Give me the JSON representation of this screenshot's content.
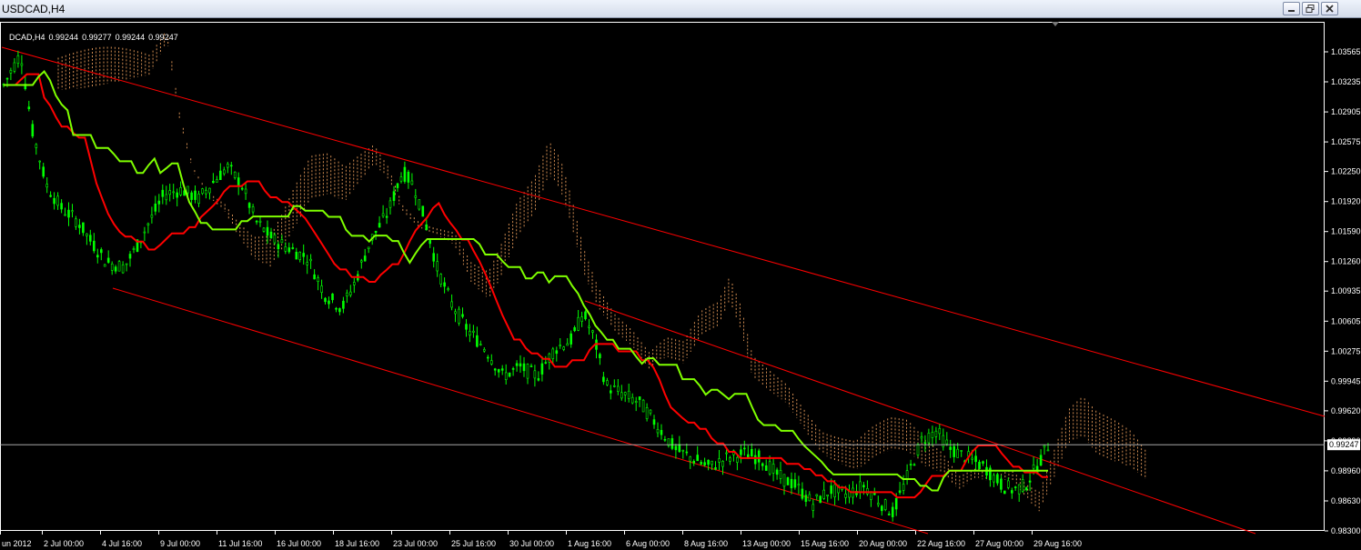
{
  "window": {
    "title": "USDCAD,H4",
    "buttons": {
      "minimize": "minimize",
      "restore": "restore",
      "close": "close"
    }
  },
  "info_line": {
    "symbol_label": "DCAD,H4",
    "open": "0.99244",
    "high": "0.99277",
    "low": "0.99244",
    "close": "0.99247"
  },
  "colors": {
    "background": "#000000",
    "candles": "#00ff00",
    "tenkan": "#ff0000",
    "kijun": "#7fff00",
    "cloud_bull": "#f4a460",
    "cloud_bear": "#ffffff",
    "channel": "#ff0000",
    "axis": "#ffffff"
  },
  "chart_data": {
    "type": "line",
    "price_axis": {
      "ticks": [
        "1.03565",
        "1.03235",
        "1.02905",
        "1.02575",
        "1.02250",
        "1.01920",
        "1.01590",
        "1.01260",
        "1.00935",
        "1.00605",
        "1.00275",
        "0.99945",
        "0.99620",
        "0.99290",
        "0.98960",
        "0.98630",
        "0.98300"
      ],
      "ylim": [
        0.983,
        1.03565
      ],
      "current_price_label": "0.99247",
      "current_price": 0.99247
    },
    "time_axis": {
      "ticks": [
        "un 2012",
        "2 Jul 00:00",
        "4 Jul 16:00",
        "9 Jul 00:00",
        "11 Jul 16:00",
        "16 Jul 00:00",
        "18 Jul 16:00",
        "23 Jul 00:00",
        "25 Jul 16:00",
        "30 Jul 00:00",
        "1 Aug 16:00",
        "6 Aug 00:00",
        "8 Aug 16:00",
        "13 Aug 00:00",
        "15 Aug 16:00",
        "20 Aug 00:00",
        "22 Aug 16:00",
        "27 Aug 00:00",
        "29 Aug 16:00"
      ]
    },
    "price_path": [
      [
        0,
        1.032
      ],
      [
        0.6,
        1.0355
      ],
      [
        1.0,
        1.027
      ],
      [
        1.5,
        1.021
      ],
      [
        2.0,
        1.0185
      ],
      [
        2.6,
        1.017
      ],
      [
        3.0,
        1.015
      ],
      [
        3.6,
        1.0125
      ],
      [
        4.2,
        1.012
      ],
      [
        4.6,
        1.014
      ],
      [
        5.0,
        1.0165
      ],
      [
        5.6,
        1.02
      ],
      [
        6.2,
        1.0205
      ],
      [
        6.8,
        1.0195
      ],
      [
        7.2,
        1.021
      ],
      [
        7.8,
        1.023
      ],
      [
        8.3,
        1.021
      ],
      [
        8.8,
        1.017
      ],
      [
        9.4,
        1.015
      ],
      [
        10.0,
        1.014
      ],
      [
        10.6,
        1.013
      ],
      [
        11.2,
        1.009
      ],
      [
        11.8,
        1.0075
      ],
      [
        12.2,
        1.01
      ],
      [
        12.8,
        1.015
      ],
      [
        13.4,
        1.018
      ],
      [
        13.9,
        1.0225
      ],
      [
        14.3,
        1.021
      ],
      [
        14.7,
        1.017
      ],
      [
        15.1,
        1.012
      ],
      [
        15.6,
        1.008
      ],
      [
        16.2,
        1.005
      ],
      [
        16.8,
        1.003
      ],
      [
        17.4,
        1.0
      ],
      [
        18.0,
        1.001
      ],
      [
        18.6,
        1.0
      ],
      [
        19.2,
        1.003
      ],
      [
        19.8,
        1.004
      ],
      [
        20.2,
        1.007
      ],
      [
        20.6,
        1.004
      ],
      [
        21.0,
        0.999
      ],
      [
        21.6,
        0.998
      ],
      [
        22.2,
        0.997
      ],
      [
        22.8,
        0.9945
      ],
      [
        23.4,
        0.992
      ],
      [
        24.0,
        0.991
      ],
      [
        24.6,
        0.99
      ],
      [
        25.2,
        0.991
      ],
      [
        25.8,
        0.9915
      ],
      [
        26.4,
        0.991
      ],
      [
        27.0,
        0.989
      ],
      [
        27.6,
        0.988
      ],
      [
        28.2,
        0.986
      ],
      [
        28.8,
        0.9875
      ],
      [
        29.4,
        0.987
      ],
      [
        30.0,
        0.988
      ],
      [
        30.6,
        0.986
      ],
      [
        31.0,
        0.985
      ],
      [
        31.5,
        0.989
      ],
      [
        32.0,
        0.993
      ],
      [
        32.5,
        0.994
      ],
      [
        33.0,
        0.992
      ],
      [
        33.6,
        0.991
      ],
      [
        34.2,
        0.99
      ],
      [
        34.8,
        0.988
      ],
      [
        35.2,
        0.9875
      ],
      [
        35.6,
        0.988
      ],
      [
        36.0,
        0.99
      ],
      [
        36.4,
        0.9924
      ]
    ]
  }
}
